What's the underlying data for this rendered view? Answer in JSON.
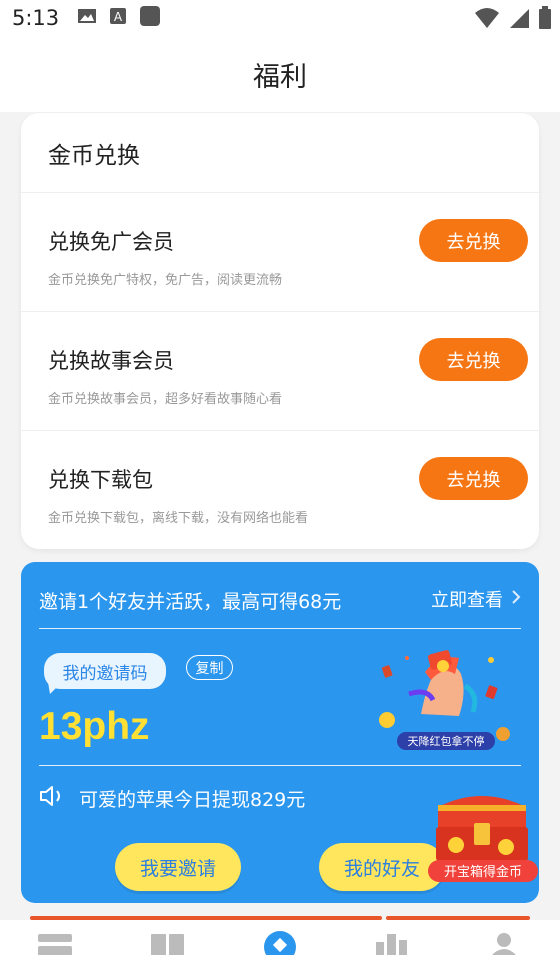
{
  "status_bar": {
    "time": "5:13",
    "left_icons": [
      "gallery-icon",
      "text-icon",
      "app-icon"
    ],
    "right_icons": [
      "wifi-icon",
      "signal-icon",
      "battery-icon"
    ]
  },
  "header": {
    "title": "福利"
  },
  "exchange": {
    "title": "金币兑换",
    "items": [
      {
        "name": "兑换免广会员",
        "desc": "金币兑换免广特权，免广告，阅读更流畅",
        "button": "去兑换"
      },
      {
        "name": "兑换故事会员",
        "desc": "金币兑换故事会员，超多好看故事随心看",
        "button": "去兑换"
      },
      {
        "name": "兑换下载包",
        "desc": "金币兑换下载包，离线下载，没有网络也能看",
        "button": "去兑换"
      }
    ]
  },
  "invite": {
    "headline": "邀请1个好友并活跃，最高可得68元",
    "view_now": "立即查看",
    "code_label": "我的邀请码",
    "copy": "复制",
    "code": "13phz",
    "banner_text": "天降红包拿不停",
    "ticker": "可爱的苹果今日提现829元",
    "invite_button": "我要邀请",
    "friends_button": "我的好友",
    "chest_label": "开宝箱得金币"
  },
  "colors": {
    "accent_orange": "#f77614",
    "invite_blue": "#2b96ee",
    "code_yellow": "#ffe033",
    "button_yellow": "#ffe65c"
  },
  "bottom_nav": {
    "icons": [
      "bookshelf-icon",
      "library-icon",
      "welfare-icon",
      "ranking-icon",
      "profile-icon"
    ]
  }
}
